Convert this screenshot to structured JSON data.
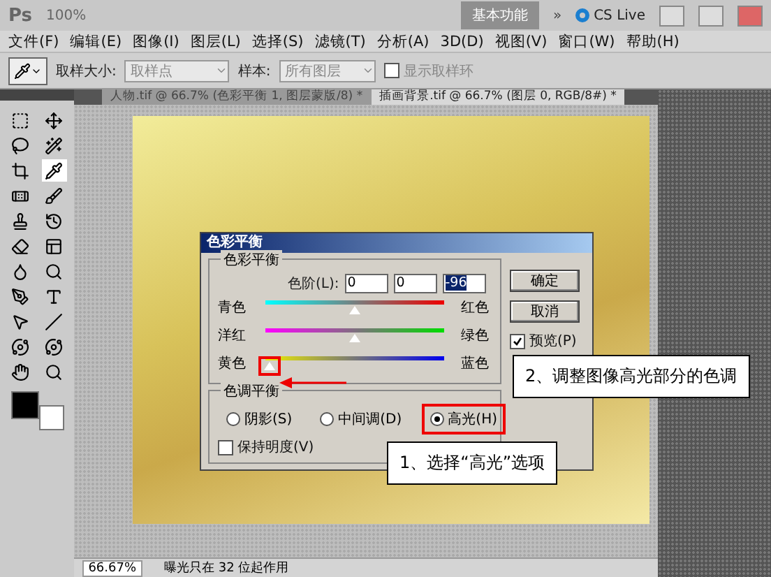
{
  "app_bar": {
    "logo": "Ps",
    "zoom": "100%",
    "workspace": "基本功能",
    "more": "»",
    "cs_live": "CS Live"
  },
  "menu": [
    "文件(F)",
    "编辑(E)",
    "图像(I)",
    "图层(L)",
    "选择(S)",
    "滤镜(T)",
    "分析(A)",
    "3D(D)",
    "视图(V)",
    "窗口(W)",
    "帮助(H)"
  ],
  "options_bar": {
    "sample_size_label": "取样大小:",
    "sample_size": "取样点",
    "sample_label": "样本:",
    "sample": "所有图层",
    "show_ring": {
      "label": "显示取样环",
      "checked": false
    }
  },
  "doc_tabs": [
    {
      "label": "人物.tif @ 66.7% (色彩平衡 1, 图层蒙版/8) *",
      "selected": false
    },
    {
      "label": "插画背景.tif @ 66.7% (图层 0, RGB/8#) *",
      "selected": true
    }
  ],
  "status_bar": {
    "zoom": "66.67%",
    "info": "曝光只在 32 位起作用"
  },
  "dialog": {
    "title": "色彩平衡",
    "balance_group": "色彩平衡",
    "levels_label": "色阶(L):",
    "levels": [
      {
        "value": "0",
        "selected": false
      },
      {
        "value": "0",
        "selected": false
      },
      {
        "value": "-96",
        "selected": true
      }
    ],
    "sliders": [
      {
        "left": "青色",
        "right": "红色",
        "level": 0.5,
        "highlighted": false
      },
      {
        "left": "洋红",
        "right": "绿色",
        "level": 0.5,
        "highlighted": false
      },
      {
        "left": "黄色",
        "right": "蓝色",
        "level": 0.02,
        "highlighted": true
      }
    ],
    "tone_group": "色调平衡",
    "tones": [
      {
        "label": "阴影(S)",
        "selected": false,
        "highlighted": false
      },
      {
        "label": "中间调(D)",
        "selected": false,
        "highlighted": false
      },
      {
        "label": "高光(H)",
        "selected": true,
        "highlighted": true
      }
    ],
    "preserve": {
      "label": "保持明度(V)",
      "checked": false
    },
    "buttons": [
      "确定",
      "取消"
    ],
    "preview": {
      "label": "预览(P)",
      "checked": true
    }
  },
  "callouts": [
    "2、调整图像高光部分的色调",
    "1、选择“高光”选项"
  ]
}
